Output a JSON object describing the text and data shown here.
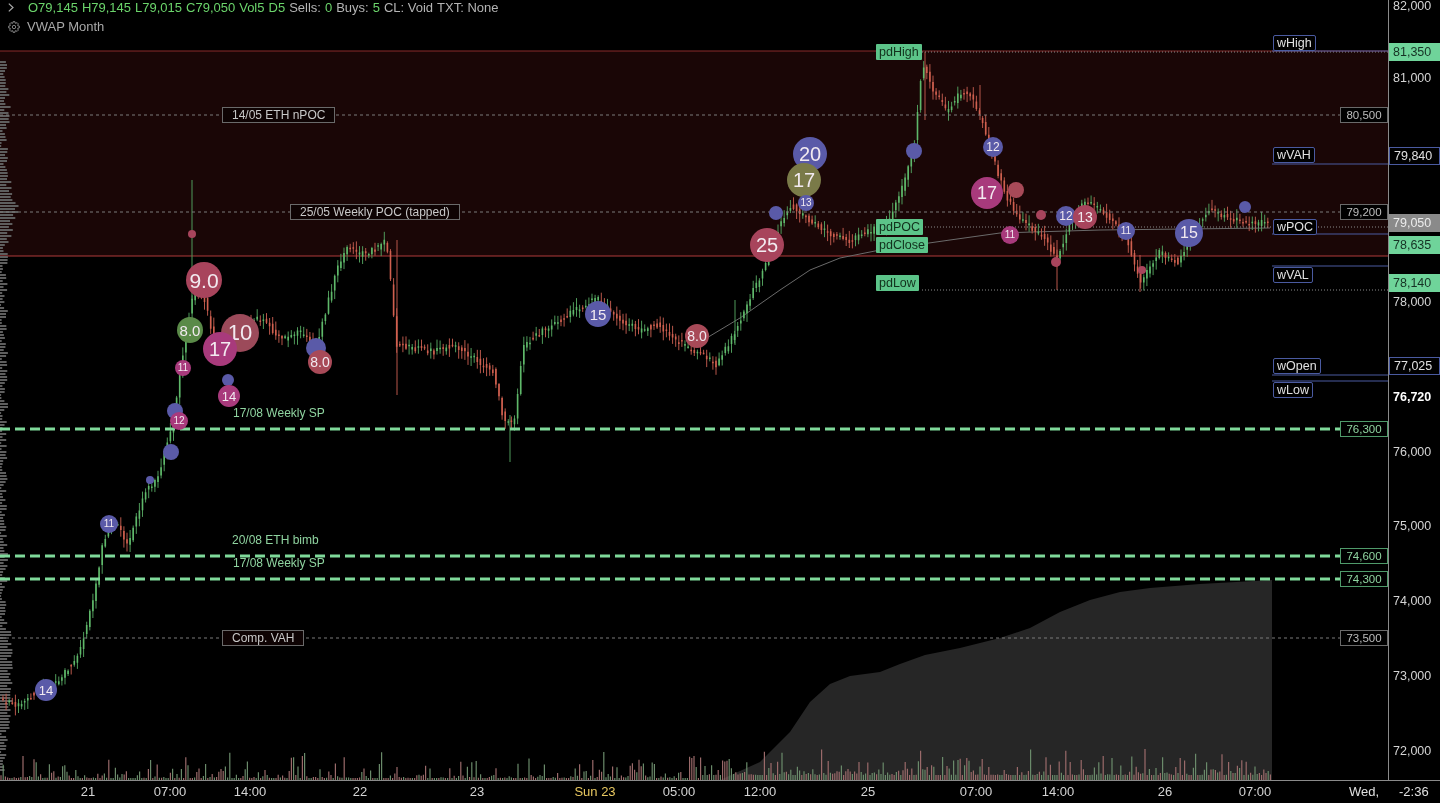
{
  "legend": {
    "segments": [
      {
        "text": "O79,145",
        "kind": "value"
      },
      {
        "text": "H79,145",
        "kind": "value"
      },
      {
        "text": "L79,015",
        "kind": "value"
      },
      {
        "text": "C79,050",
        "kind": "value"
      },
      {
        "text": "Vol5",
        "kind": "value"
      },
      {
        "text": "D5",
        "kind": "value"
      },
      {
        "text": "Sells:",
        "kind": "label"
      },
      {
        "text": "0",
        "kind": "value"
      },
      {
        "text": "Buys:",
        "kind": "label"
      },
      {
        "text": "5",
        "kind": "value"
      },
      {
        "text": "CL: Void",
        "kind": "label"
      },
      {
        "text": "TXT: None",
        "kind": "label"
      }
    ],
    "indicator": "VWAP Month"
  },
  "levels": [
    {
      "kind": "reference",
      "label": "14/05 ETH nPOC",
      "price": "80,500"
    },
    {
      "kind": "reference",
      "label": "25/05 Weekly POC (tapped)",
      "price": "79,200"
    },
    {
      "kind": "support",
      "label": "17/08 Weekly SP",
      "price": "76,300"
    },
    {
      "kind": "support",
      "label": "20/08 ETH bimb",
      "price": "74,600"
    },
    {
      "kind": "support",
      "label": "17/08 Weekly SP",
      "price": "74,300"
    },
    {
      "kind": "reference",
      "label": "Comp. VAH",
      "price": "73,500"
    }
  ],
  "previous_day": [
    "pdHigh",
    "pdPOC",
    "pdClose",
    "pdLow"
  ],
  "weekly": [
    "wHigh",
    "wVAH",
    "wPOC",
    "wVAL",
    "wOpen",
    "wLow"
  ],
  "dots": [
    {
      "color": "#5a5aa8"
    },
    {
      "color": "#a84a58"
    },
    {
      "color": "#5a5aa8"
    },
    {
      "color": "#5a5aa8"
    },
    {
      "color": "#5a5aa8"
    },
    {
      "color": "#5a5aa8"
    },
    {
      "color": "#5a5aa8"
    },
    {
      "color": "#5a5aa8"
    },
    {
      "color": "#a8445c"
    },
    {
      "color": "#a8445c"
    },
    {
      "color": "#a8445c"
    },
    {
      "color": "#a8445c"
    },
    {
      "color": "#5a5aa8"
    }
  ],
  "bubbles": [
    {
      "label": "9.0",
      "color": "#a8445c"
    },
    {
      "label": "8.0",
      "color": "#5a8a48"
    },
    {
      "label": "10",
      "color": "#9c4a5a"
    },
    {
      "label": "17",
      "color": "#a83a7c"
    },
    {
      "label": "8.0",
      "color": "#a84a58"
    },
    {
      "label": "11",
      "color": "#a83a7c"
    },
    {
      "label": "14",
      "color": "#a83a7c"
    },
    {
      "label": "12",
      "color": "#a83a7c"
    },
    {
      "label": "11",
      "color": "#5a5aa8"
    },
    {
      "label": "14",
      "color": "#5a5aa8"
    },
    {
      "label": "15",
      "color": "#5a5aa8"
    },
    {
      "label": "8.0",
      "color": "#a84a58"
    },
    {
      "label": "25",
      "color": "#a8445c"
    },
    {
      "label": "20",
      "color": "#5a5aa8"
    },
    {
      "label": "17",
      "color": "#7a7a48"
    },
    {
      "label": "13",
      "color": "#5a5aa8"
    },
    {
      "label": "12",
      "color": "#5a5aa8"
    },
    {
      "label": "17",
      "color": "#a83a7c"
    },
    {
      "label": "11",
      "color": "#a83a7c"
    },
    {
      "label": "12",
      "color": "#5a5aa8"
    },
    {
      "label": "13",
      "color": "#a8445c"
    },
    {
      "label": "11",
      "color": "#5a5aa8"
    },
    {
      "label": "15",
      "color": "#5a5aa8"
    }
  ],
  "price_axis": [
    {
      "text": "82,000",
      "kind": "tick"
    },
    {
      "text": "81,350",
      "kind": "highlight"
    },
    {
      "text": "81,000",
      "kind": "tick"
    },
    {
      "text": "79,840",
      "kind": "marker"
    },
    {
      "text": "79,050",
      "kind": "current"
    },
    {
      "text": "78,635",
      "kind": "highlight"
    },
    {
      "text": "78,140",
      "kind": "highlight"
    },
    {
      "text": "78,000",
      "kind": "tick"
    },
    {
      "text": "77,025",
      "kind": "marker"
    },
    {
      "text": "76,720",
      "kind": "emphasis"
    },
    {
      "text": "76,000",
      "kind": "tick"
    },
    {
      "text": "75,000",
      "kind": "tick"
    },
    {
      "text": "74,000",
      "kind": "tick"
    },
    {
      "text": "73,000",
      "kind": "tick"
    },
    {
      "text": "72,000",
      "kind": "tick"
    }
  ],
  "time_axis": {
    "labels": [
      {
        "text": "21",
        "kind": "tick"
      },
      {
        "text": "07:00",
        "kind": "tick"
      },
      {
        "text": "14:00",
        "kind": "tick"
      },
      {
        "text": "22",
        "kind": "tick"
      },
      {
        "text": "23",
        "kind": "tick"
      },
      {
        "text": "Sun 23",
        "kind": "session"
      },
      {
        "text": "05:00",
        "kind": "tick"
      },
      {
        "text": "12:00",
        "kind": "tick"
      },
      {
        "text": "25",
        "kind": "tick"
      },
      {
        "text": "07:00",
        "kind": "tick"
      },
      {
        "text": "14:00",
        "kind": "tick"
      },
      {
        "text": "26",
        "kind": "tick"
      },
      {
        "text": "07:00",
        "kind": "tick"
      }
    ],
    "cursor": "Wed,",
    "countdown": "-2:36"
  }
}
